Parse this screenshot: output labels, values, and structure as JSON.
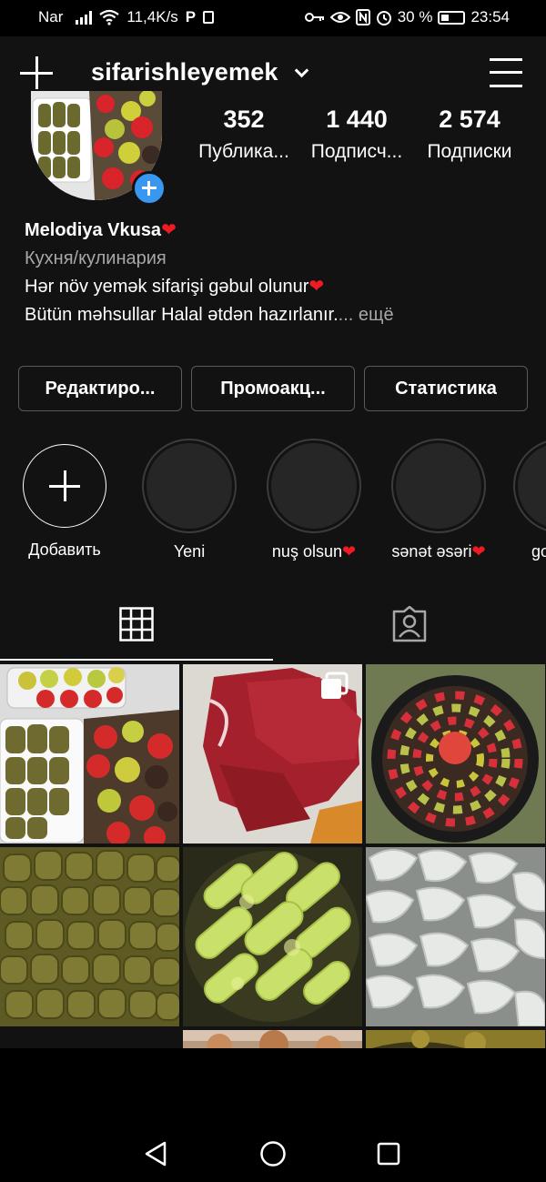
{
  "status_bar": {
    "carrier": "Nar",
    "speed": "11,4K/s",
    "p_icon": "P",
    "battery_percent": "30 %",
    "time": "23:54"
  },
  "header": {
    "username": "sifarishleyemek",
    "icons": [
      "new-post-plus-icon",
      "dropdown-chevron-icon",
      "hamburger-menu-icon"
    ]
  },
  "stats": [
    {
      "num": "352",
      "label": "Публика..."
    },
    {
      "num": "1 440",
      "label": "Подписч..."
    },
    {
      "num": "2 574",
      "label": "Подписки"
    }
  ],
  "bio": {
    "name": "Melodiya Vkusa",
    "category": "Кухня/кулинария",
    "line1": "Hər növ yemək sifarişi gəbul olunur",
    "line2": "Bütün məhsullar Halal ətdən hazırlanır.",
    "more_dots": "...",
    "more": " ещё",
    "heart": "❤"
  },
  "buttons": {
    "edit": "Редактиро...",
    "promo": "Промоакц...",
    "stats": "Статистика"
  },
  "highlights": [
    {
      "label": "Добавить"
    },
    {
      "label": "Yeni"
    },
    {
      "label": "nuş olsun"
    },
    {
      "label": "sənət əsəri"
    },
    {
      "label": "go"
    }
  ],
  "tabs": [
    "grid-icon",
    "tagged-person-icon"
  ],
  "colors": {
    "background": "#121212",
    "accent_blue": "#3897f0",
    "heart_red": "#ed1c24",
    "muted_text": "#a8a8a8"
  },
  "bottom_nav": [
    "home-icon",
    "search-icon",
    "new-post-icon",
    "activity-heart-icon",
    "profile-avatar"
  ],
  "system_nav": [
    "back-icon",
    "home-circle-icon",
    "recents-square-icon"
  ]
}
